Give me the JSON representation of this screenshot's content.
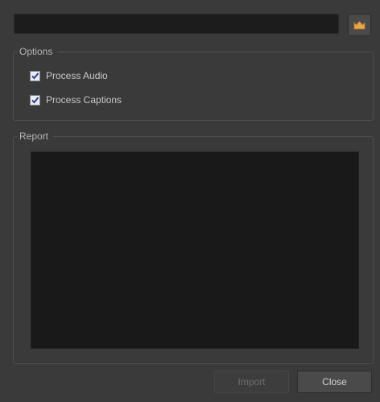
{
  "path_field": {
    "value": "",
    "placeholder": ""
  },
  "browse_button": {
    "icon": "folder-icon",
    "icon_color": "#e8a64a"
  },
  "options": {
    "title": "Options",
    "items": [
      {
        "label": "Process Audio",
        "checked": true
      },
      {
        "label": "Process Captions",
        "checked": true
      }
    ]
  },
  "report": {
    "title": "Report",
    "content": ""
  },
  "buttons": {
    "import_label": "Import",
    "import_enabled": false,
    "close_label": "Close"
  },
  "colors": {
    "background": "#3a3a3a",
    "field_background": "#1c1c1c",
    "report_background": "#191919",
    "checkmark": "#2b3f8a"
  }
}
